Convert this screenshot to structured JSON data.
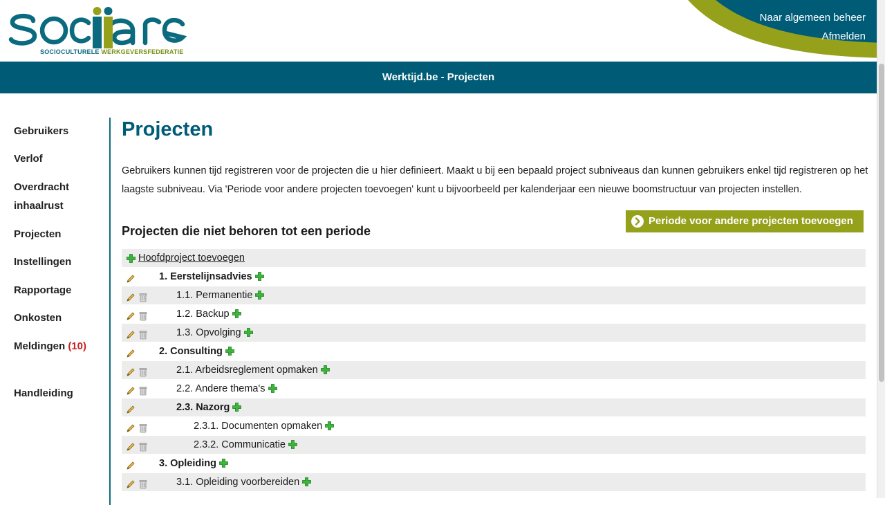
{
  "brand": {
    "logo_text": "SOCiare",
    "logo_sub_a": "SOCIOCULTURELE",
    "logo_sub_b": "WERKGEVERSFEDERATIE",
    "primary_color": "#005b77",
    "accent_color": "#95a11b"
  },
  "header": {
    "links": [
      "Naar algemeen beheer",
      "Afmelden"
    ],
    "title": "Werktijd.be - Projecten"
  },
  "sidebar": {
    "items": [
      {
        "label": "Gebruikers"
      },
      {
        "label": "Verlof"
      },
      {
        "label": "Overdracht",
        "label2": "inhaalrust"
      },
      {
        "label": "Projecten"
      },
      {
        "label": "Instellingen"
      },
      {
        "label": "Rapportage"
      },
      {
        "label": "Onkosten"
      },
      {
        "label": "Meldingen",
        "count": "(10)"
      },
      {
        "label": "Handleiding"
      }
    ]
  },
  "main": {
    "title": "Projecten",
    "intro": "Gebruikers kunnen tijd registreren voor de projecten die u hier definieert. Maakt u bij een bepaald project subniveaus dan kunnen gebruikers enkel tijd registreren op het laagste subniveau. Via 'Periode voor andere projecten toevoegen' kunt u bijvoorbeeld per kalenderjaar een nieuwe boomstructuur van projecten instellen.",
    "section_title": "Projecten die niet behoren tot een periode",
    "period_button": "Periode voor andere projecten toevoegen",
    "add_main_project": "Hoofdproject toevoegen",
    "projects": [
      {
        "label": "1. Eerstelijnsadvies",
        "level": 0,
        "bold": true,
        "deletable": false
      },
      {
        "label": "1.1. Permanentie",
        "level": 1,
        "bold": false,
        "deletable": true
      },
      {
        "label": "1.2. Backup",
        "level": 1,
        "bold": false,
        "deletable": true
      },
      {
        "label": "1.3. Opvolging",
        "level": 1,
        "bold": false,
        "deletable": true
      },
      {
        "label": "2. Consulting",
        "level": 0,
        "bold": true,
        "deletable": false
      },
      {
        "label": "2.1. Arbeidsreglement opmaken",
        "level": 1,
        "bold": false,
        "deletable": true
      },
      {
        "label": "2.2. Andere thema's",
        "level": 1,
        "bold": false,
        "deletable": true
      },
      {
        "label": "2.3. Nazorg",
        "level": 1,
        "bold": true,
        "deletable": false
      },
      {
        "label": "2.3.1. Documenten opmaken",
        "level": 2,
        "bold": false,
        "deletable": true
      },
      {
        "label": "2.3.2. Communicatie",
        "level": 2,
        "bold": false,
        "deletable": true
      },
      {
        "label": "3. Opleiding",
        "level": 0,
        "bold": true,
        "deletable": false
      },
      {
        "label": "3.1. Opleiding voorbereiden",
        "level": 1,
        "bold": false,
        "deletable": true
      }
    ]
  }
}
